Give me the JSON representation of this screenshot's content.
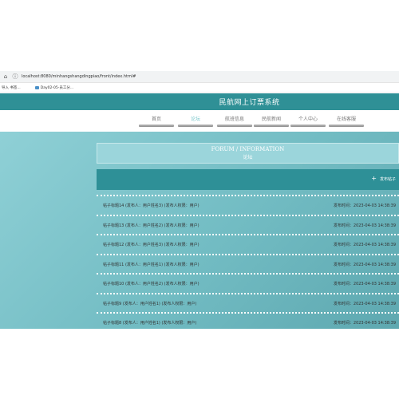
{
  "browser": {
    "url": "localhost:8080/minhangshangdingpiao/front/index.html#",
    "bookmarks": [
      "导入 书签...",
      "Day02-05-员工分..."
    ]
  },
  "site": {
    "title": "民航网上订票系统"
  },
  "nav": [
    {
      "label": "首页"
    },
    {
      "label": "论坛"
    },
    {
      "label": "航班信息"
    },
    {
      "label": "民航新闻"
    },
    {
      "label": "个人中心"
    },
    {
      "label": "在线客服"
    }
  ],
  "section": {
    "title_en": "FORUM / INFORMATION",
    "title_zh": "论坛"
  },
  "post_button": {
    "label": "发布帖子",
    "icon": "plus-icon"
  },
  "posts": [
    {
      "title": "帖子标题14  (发布人：用户姓名3)   (发布人权限：用户)",
      "date": "发布时间：2023-04-03 14:38:39"
    },
    {
      "title": "帖子标题13  (发布人：用户姓名2)   (发布人权限：用户)",
      "date": "发布时间：2023-04-03 14:38:39"
    },
    {
      "title": "帖子标题12  (发布人：用户姓名3)   (发布人权限：用户)",
      "date": "发布时间：2023-04-03 14:38:39"
    },
    {
      "title": "帖子标题11  (发布人：用户姓名1)   (发布人权限：用户)",
      "date": "发布时间：2023-04-03 14:38:39"
    },
    {
      "title": "帖子标题10  (发布人：用户姓名2)   (发布人权限：用户)",
      "date": "发布时间：2023-04-03 14:38:39"
    },
    {
      "title": "帖子标题9  (发布人：用户姓名1)   (发布人权限：用户)",
      "date": "发布时间：2023-04-03 14:38:39"
    },
    {
      "title": "帖子标题8  (发布人：用户姓名1)   (发布人权限：用户)",
      "date": "发布时间：2023-04-03 14:38:39"
    }
  ],
  "colors": {
    "header": "#2f9096",
    "post_bar": "#2e9097",
    "background": "#7fc4ca",
    "nav_active": "#7cc8cc"
  }
}
